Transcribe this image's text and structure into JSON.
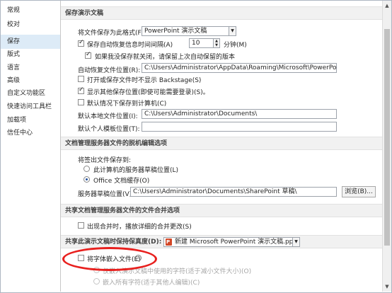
{
  "sidebar": {
    "items": [
      {
        "label": "常规"
      },
      {
        "label": "校对"
      },
      {
        "label": "保存"
      },
      {
        "label": "版式"
      },
      {
        "label": "语言"
      },
      {
        "label": "高级"
      },
      {
        "label": "自定义功能区"
      },
      {
        "label": "快速访问工具栏"
      },
      {
        "label": "加载项"
      },
      {
        "label": "信任中心"
      }
    ],
    "selected_index": 2
  },
  "save_presentations": {
    "header": "保存演示文稿",
    "format_label": "将文件保存为此格式(F):",
    "format_value": "PowerPoint 演示文稿",
    "autorecover_label": "保存自动恢复信息时间间隔(A)",
    "autorecover_checked": true,
    "autorecover_minutes": "10",
    "minutes_label": "分钟(M)",
    "keep_last_label": "如果我没保存就关闭，请保留上次自动保留的版本",
    "keep_last_checked": true,
    "autorecover_location_label": "自动恢复文件位置(R):",
    "autorecover_location_value": "C:\\Users\\Administrator\\AppData\\Roaming\\Microsoft\\PowerPoint\\",
    "no_backstage_label": "打开或保存文件时不显示 Backstage(S)",
    "no_backstage_checked": false,
    "show_other_label": "显示其他保存位置(即使可能需要登录)(S)。",
    "show_other_checked": true,
    "default_computer_label": "默认情况下保存到计算机(C)",
    "default_computer_checked": false,
    "default_local_label": "默认本地文件位置(I):",
    "default_local_value": "C:\\Users\\Administrator\\Documents\\",
    "personal_templates_label": "默认个人模板位置(T):",
    "personal_templates_value": ""
  },
  "offline_editing": {
    "header": "文档管理服务器文件的脱机编辑选项",
    "save_to_label": "将签出文件保存到:",
    "option_server_drafts": "此计算机的服务器草稿位置(L)",
    "option_office_cache": "Office 文档缓存(O)",
    "selected": "option_office_cache",
    "drafts_location_label": "服务器草稿位置(V):",
    "drafts_location_value": "C:\\Users\\Administrator\\Documents\\SharePoint 草稿\\",
    "browse_label": "浏览(B)..."
  },
  "merge": {
    "header": "共享文档管理服务器文件的文件合并选项",
    "show_changes_label": "出现合并时，播放详细的合并更改(S)",
    "show_changes_checked": false
  },
  "fidelity": {
    "header": "共享此演示文稿时保持保真度(D):",
    "document_value": "新建 Microsoft PowerPoint 演示文稿.pptx",
    "embed_fonts_label": "将字体嵌入文件(E)",
    "embed_fonts_checked": false,
    "info_icon": "info-icon",
    "option_used_chars": "仅嵌入演示文稿中使用的字符(适于减小文件大小)(O)",
    "option_all_chars": "嵌入所有字符(适于其他人编辑)(C)"
  },
  "colors": {
    "selected_nav": "#ddebf7",
    "section_header": "#f1f1f1",
    "annotation": "#e8201e"
  }
}
